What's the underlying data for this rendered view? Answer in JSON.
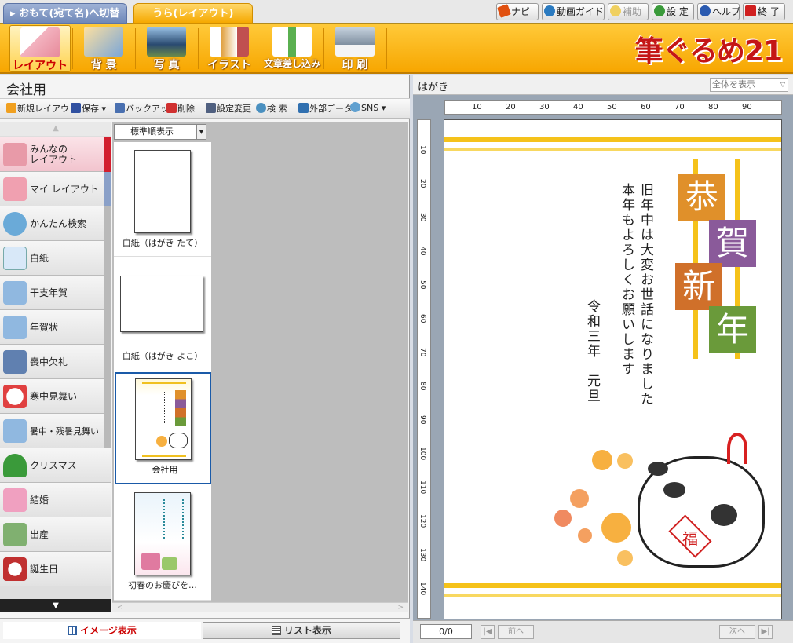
{
  "tabs": {
    "front": "▸ おもて(宛て名)へ切替",
    "back": "うら(レイアウト)"
  },
  "top_buttons": [
    {
      "label": "ナビ",
      "icon": "cursor-icon",
      "color": "#e05010"
    },
    {
      "label": "動画ガイド",
      "icon": "play-icon",
      "color": "#2a7ac0"
    },
    {
      "label": "補助",
      "icon": "star-icon",
      "color": "#f0c020",
      "disabled": true
    },
    {
      "label": "設 定",
      "icon": "wrench-icon",
      "color": "#3a9a3a"
    },
    {
      "label": "ヘルプ",
      "icon": "help-icon",
      "color": "#2a5ab0"
    },
    {
      "label": "終 了",
      "icon": "close-icon",
      "color": "#d02020"
    }
  ],
  "ribbon": [
    {
      "label": "レイアウト",
      "icon": "layout-icon",
      "color": "#e78a9a"
    },
    {
      "label": "背 景",
      "icon": "background-icon",
      "color": "#7aa6d8"
    },
    {
      "label": "写 真",
      "icon": "photo-icon",
      "color": "#4a7ab0"
    },
    {
      "label": "イラスト",
      "icon": "illustration-icon",
      "color": "#e0a040"
    },
    {
      "label": "文章差し込み",
      "icon": "text-insert-icon",
      "color": "#5ab050"
    },
    {
      "label": "印 刷",
      "icon": "printer-icon",
      "color": "#8090a0"
    }
  ],
  "logo": "筆ぐるめ21",
  "left_title": "会社用",
  "left_toolbar": [
    {
      "label": "新規レイアウト",
      "icon": "new-layout-icon",
      "color": "#f0a020"
    },
    {
      "label": "保存 ▾",
      "icon": "save-icon",
      "color": "#3050a0"
    },
    {
      "label": "バックアップ",
      "icon": "backup-icon",
      "color": "#4a70b0"
    },
    {
      "label": "削除",
      "icon": "delete-icon",
      "color": "#d03030"
    },
    {
      "label": "設定変更",
      "icon": "settings-change-icon",
      "color": "#506080"
    },
    {
      "label": "検 索",
      "icon": "search-icon",
      "color": "#4a90c0"
    },
    {
      "label": "外部データ",
      "icon": "external-data-icon",
      "color": "#3070b0"
    },
    {
      "label": "SNS ▾",
      "icon": "sns-icon",
      "color": "#60a0d0"
    }
  ],
  "categories": [
    {
      "label": "みんなの\nレイアウト",
      "icon": "people-icon",
      "color": "#e89aa8",
      "selected": true
    },
    {
      "label": "マイ レイアウト",
      "icon": "my-layout-icon",
      "color": "#f0a0b0"
    },
    {
      "label": "かんたん検索",
      "icon": "magnifier-icon",
      "color": "#6aaad8"
    },
    {
      "label": "白紙",
      "icon": "blank-page-icon",
      "color": "#d8e8f8"
    },
    {
      "label": "干支年賀",
      "icon": "card-icon",
      "color": "#90b8e0"
    },
    {
      "label": "年賀状",
      "icon": "card-icon",
      "color": "#90b8e0"
    },
    {
      "label": "喪中欠礼",
      "icon": "mourning-icon",
      "color": "#6080b0"
    },
    {
      "label": "寒中見舞い",
      "icon": "snowman-icon",
      "color": "#e04040"
    },
    {
      "label": "暑中・残暑見舞い",
      "icon": "card-icon",
      "color": "#90b8e0"
    },
    {
      "label": "クリスマス",
      "icon": "christmas-tree-icon",
      "color": "#3a9a3a"
    },
    {
      "label": "結婚",
      "icon": "wedding-icon",
      "color": "#f0a0c0"
    },
    {
      "label": "出産",
      "icon": "baby-icon",
      "color": "#80b070"
    },
    {
      "label": "誕生日",
      "icon": "birthday-icon",
      "color": "#c03030"
    }
  ],
  "sort": "標準順表示",
  "thumbs": [
    {
      "label": "白紙（はがき たて）"
    },
    {
      "label": "白紙（はがき よこ）"
    },
    {
      "label": "会社用",
      "selected": true
    },
    {
      "label": "初春のお慶びを…"
    }
  ],
  "view_tabs": {
    "image": "イメージ表示",
    "list": "リスト表示"
  },
  "preview": {
    "title": "はがき",
    "zoom": "全体を表示",
    "ruler_x": [
      "10",
      "20",
      "30",
      "40",
      "50",
      "60",
      "70",
      "80",
      "90"
    ],
    "ruler_y": [
      "10",
      "20",
      "30",
      "40",
      "50",
      "60",
      "70",
      "80",
      "90",
      "100",
      "110",
      "120",
      "130",
      "140"
    ],
    "greeting_chars": [
      "恭",
      "賀",
      "新",
      "年"
    ],
    "greeting_colors": [
      "#e0902a",
      "#8a5a9a",
      "#d0702a",
      "#6a9a3a"
    ],
    "body_lines": [
      "旧年中は大変お世話になりました",
      "本年もよろしくお願いします"
    ],
    "date_line": "令和三年　元旦",
    "charm_char": "福",
    "page": "0/0",
    "prev": "前へ",
    "next": "次へ"
  }
}
